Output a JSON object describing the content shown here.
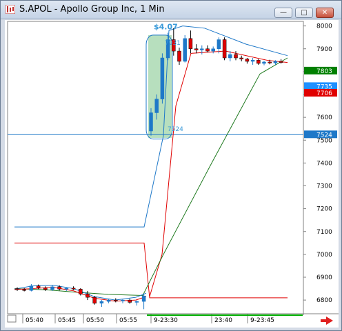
{
  "window": {
    "title": "S.APOL - Apollo Group Inc, 1 Min",
    "minimize_glyph": "—",
    "maximize_glyph": "□",
    "close_glyph": "✕"
  },
  "chart_data": {
    "type": "candlestick",
    "title": "",
    "ylim": [
      6740,
      8020
    ],
    "y_ticks": [
      8000,
      7900,
      7800,
      7700,
      7600,
      7500,
      7400,
      7300,
      7200,
      7100,
      7000,
      6900,
      6800
    ],
    "x_tick_labels": [
      "05:40",
      "05:45",
      "05:50",
      "05:55",
      "9-23:30",
      "23:40",
      "9-23:45"
    ],
    "price_labels": [
      {
        "text": "7803",
        "value": 7803,
        "color": "#008000"
      },
      {
        "text": "7735",
        "value": 7735,
        "color": "#1e90ff"
      },
      {
        "text": "7706",
        "value": 7706,
        "color": "#e00000"
      },
      {
        "text": "7524",
        "value": 7524,
        "color": "#1e78c8"
      }
    ],
    "annotations": [
      {
        "text": "$4.07",
        "color": "#3a9ad9"
      },
      {
        "text": "7931",
        "color": "#3a9ad9"
      },
      {
        "text": "7524",
        "color": "#3a9ad9"
      }
    ],
    "level_line": 7524,
    "candles_premarket": [
      [
        6850,
        6856,
        6840,
        6846
      ],
      [
        6846,
        6852,
        6838,
        6842
      ],
      [
        6842,
        6870,
        6838,
        6862
      ],
      [
        6862,
        6868,
        6848,
        6854
      ],
      [
        6854,
        6860,
        6840,
        6846
      ],
      [
        6846,
        6866,
        6840,
        6858
      ],
      [
        6858,
        6864,
        6842,
        6848
      ],
      [
        6848,
        6856,
        6840,
        6852
      ],
      [
        6852,
        6860,
        6844,
        6848
      ],
      [
        6848,
        6852,
        6820,
        6826
      ],
      [
        6826,
        6840,
        6800,
        6812
      ],
      [
        6812,
        6818,
        6780,
        6786
      ],
      [
        6786,
        6800,
        6770,
        6794
      ],
      [
        6794,
        6806,
        6786,
        6800
      ],
      [
        6800,
        6808,
        6790,
        6796
      ],
      [
        6796,
        6804,
        6786,
        6800
      ],
      [
        6800,
        6806,
        6784,
        6790
      ],
      [
        6790,
        6798,
        6776,
        6794
      ],
      [
        6794,
        6828,
        6760,
        6818
      ]
    ],
    "candles_open": [
      [
        7540,
        7640,
        7520,
        7620
      ],
      [
        7620,
        7700,
        7590,
        7680
      ],
      [
        7680,
        7880,
        7660,
        7860
      ],
      [
        7860,
        7970,
        7850,
        7940
      ],
      [
        7940,
        7990,
        7870,
        7890
      ],
      [
        7890,
        7905,
        7830,
        7845
      ],
      [
        7845,
        7960,
        7840,
        7945
      ],
      [
        7945,
        7980,
        7880,
        7900
      ],
      [
        7900,
        7920,
        7880,
        7895
      ],
      [
        7895,
        7915,
        7875,
        7900
      ],
      [
        7900,
        7915,
        7885,
        7890
      ],
      [
        7890,
        7910,
        7880,
        7900
      ],
      [
        7900,
        7950,
        7880,
        7940
      ],
      [
        7940,
        7950,
        7850,
        7860
      ],
      [
        7860,
        7890,
        7845,
        7875
      ],
      [
        7875,
        7890,
        7850,
        7860
      ],
      [
        7860,
        7870,
        7845,
        7855
      ],
      [
        7855,
        7860,
        7835,
        7845
      ],
      [
        7845,
        7860,
        7830,
        7850
      ],
      [
        7850,
        7855,
        7830,
        7836
      ],
      [
        7836,
        7848,
        7828,
        7842
      ],
      [
        7842,
        7852,
        7832,
        7838
      ],
      [
        7838,
        7850,
        7830,
        7845
      ],
      [
        7845,
        7855,
        7835,
        7840
      ]
    ],
    "series": [
      {
        "color": "#1e78c8",
        "values": [
          7120,
          7520,
          7980,
          8000,
          7870
        ]
      },
      {
        "color": "#e00000",
        "values": [
          7050,
          6810,
          7760,
          7880,
          7840
        ]
      },
      {
        "color": "#1f7a1f",
        "values": [
          6880,
          6820,
          7000,
          7650,
          7860
        ]
      }
    ]
  }
}
